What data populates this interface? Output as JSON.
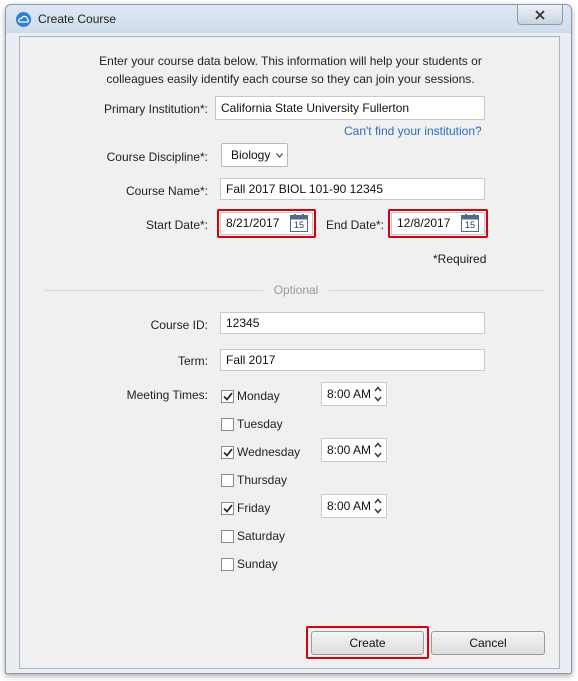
{
  "window": {
    "title": "Create Course",
    "close_icon": "close-icon"
  },
  "intro": {
    "line1": "Enter your course data below. This information will help your students or",
    "line2": "colleagues easily identify each course so they can join your sessions."
  },
  "form": {
    "institution": {
      "label": "Primary Institution*:",
      "value": "California State University Fullerton"
    },
    "cant_find_link": "Can't find your institution?",
    "discipline": {
      "label": "Course Discipline*:",
      "value": "Biology"
    },
    "course_name": {
      "label": "Course Name*:",
      "value": "Fall 2017 BIOL 101-90 12345"
    },
    "start_date": {
      "label": "Start Date*:",
      "value": "8/21/2017"
    },
    "end_date": {
      "label": "End Date*:",
      "value": "12/8/2017"
    },
    "calendar_icon_text": "15",
    "required_note": "*Required",
    "optional_heading": "Optional",
    "course_id": {
      "label": "Course ID:",
      "value": "12345"
    },
    "term": {
      "label": "Term:",
      "value": "Fall 2017"
    },
    "meeting_times": {
      "label": "Meeting Times:",
      "days": [
        {
          "name": "Monday",
          "checked": true,
          "time": "8:00 AM"
        },
        {
          "name": "Tuesday",
          "checked": false,
          "time": ""
        },
        {
          "name": "Wednesday",
          "checked": true,
          "time": "8:00 AM"
        },
        {
          "name": "Thursday",
          "checked": false,
          "time": ""
        },
        {
          "name": "Friday",
          "checked": true,
          "time": "8:00 AM"
        },
        {
          "name": "Saturday",
          "checked": false,
          "time": ""
        },
        {
          "name": "Sunday",
          "checked": false,
          "time": ""
        }
      ]
    }
  },
  "buttons": {
    "create": "Create",
    "cancel": "Cancel"
  },
  "colors": {
    "highlight": "#d6000f",
    "link": "#2a6ebd",
    "accent": "#2f7fd6"
  }
}
